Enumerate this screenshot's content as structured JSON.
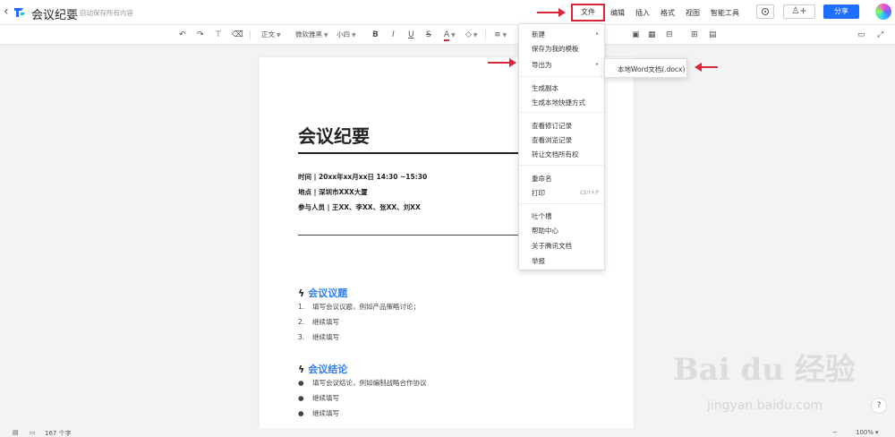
{
  "header": {
    "back_icon": "‹",
    "title": "会议纪要",
    "save_status": "自动保存所有内容",
    "menus": [
      "文件",
      "编辑",
      "插入",
      "格式",
      "视图",
      "智能工具"
    ],
    "collab_icon": "♙+",
    "share": "分享"
  },
  "toolbar": {
    "style": "正文",
    "font": "微软雅黑",
    "size": "小四",
    "bold": "B",
    "italic": "I",
    "underline": "U",
    "strike": "S",
    "font_color": "A",
    "highlight": "◇"
  },
  "document": {
    "title": "会议纪要",
    "meta": [
      "时间 | 20xx年xx月xx日 14:30 ~15:30",
      "地点 | 深圳市XXX大厦",
      "参与人员 | 王XX、李XX、张XX、刘XX"
    ],
    "sections": [
      {
        "title": "会议议题",
        "items": [
          {
            "mark": "1.",
            "text": "填写会议议题，例如产品策略讨论；"
          },
          {
            "mark": "2.",
            "text": "继续填写"
          },
          {
            "mark": "3.",
            "text": "继续填写"
          }
        ]
      },
      {
        "title": "会议结论",
        "items": [
          {
            "mark": "●",
            "text": "填写会议结论，例如编制战略合作协议"
          },
          {
            "mark": "●",
            "text": "继续填写"
          },
          {
            "mark": "●",
            "text": "继续填写"
          }
        ]
      }
    ]
  },
  "file_menu": {
    "items": [
      {
        "label": "新建",
        "submenu": true
      },
      {
        "label": "保存为我的模板"
      },
      {
        "label": "导出为",
        "submenu": true
      },
      {
        "label": "生成副本"
      },
      {
        "label": "生成本地快捷方式"
      },
      {
        "label": "查看修订记录"
      },
      {
        "label": "查看浏览记录"
      },
      {
        "label": "转让文档所有权"
      },
      {
        "label": "重命名"
      },
      {
        "label": "打印",
        "shortcut": "Ctrl+P"
      },
      {
        "label": "吐个槽"
      },
      {
        "label": "帮助中心"
      },
      {
        "label": "关于腾讯文档"
      },
      {
        "label": "举报"
      }
    ],
    "export_submenu": [
      "本地Word文档(.docx)"
    ]
  },
  "status_bar": {
    "word_count": "167 个字",
    "zoom": "100%"
  },
  "help": "?",
  "watermark": {
    "text": "Bai du 经验",
    "url": "jingyan.baidu.com"
  },
  "colors": {
    "accent": "#1e6fff",
    "section_title": "#2f7cf6",
    "annotation": "#d9263b"
  }
}
